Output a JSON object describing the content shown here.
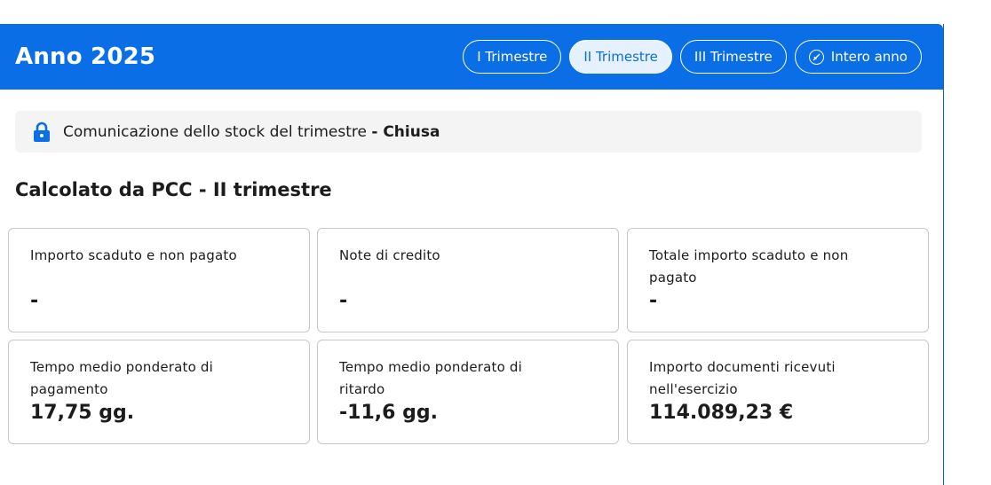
{
  "header": {
    "title": "Anno 2025",
    "tabs": [
      {
        "label": "I Trimestre",
        "active": false
      },
      {
        "label": "II Trimestre",
        "active": true
      },
      {
        "label": "III Trimestre",
        "active": false
      },
      {
        "label": "Intero anno",
        "active": false,
        "icon": "check-circle-icon"
      }
    ]
  },
  "status": {
    "icon": "lock-icon",
    "text": "Comunicazione dello stock del trimestre",
    "state": "- Chiusa"
  },
  "section": {
    "title": "Calcolato da PCC - II trimestre"
  },
  "cards": [
    {
      "label": "Importo scaduto e non pagato",
      "value": "-"
    },
    {
      "label": "Note di credito",
      "value": "-"
    },
    {
      "label": "Totale importo scaduto e non pagato",
      "value": "-"
    },
    {
      "label": "Tempo medio ponderato di pagamento",
      "value": "17,75 gg."
    },
    {
      "label": "Tempo medio ponderato di ritardo",
      "value": "-11,6 gg."
    },
    {
      "label": "Importo documenti ricevuti nell'esercizio",
      "value": "114.089,23 €"
    }
  ],
  "colors": {
    "primary": "#0a6ee6",
    "active_tab_bg": "#e6f1ff",
    "status_bg": "#f4f4f4",
    "card_border": "#c8c8c8"
  }
}
